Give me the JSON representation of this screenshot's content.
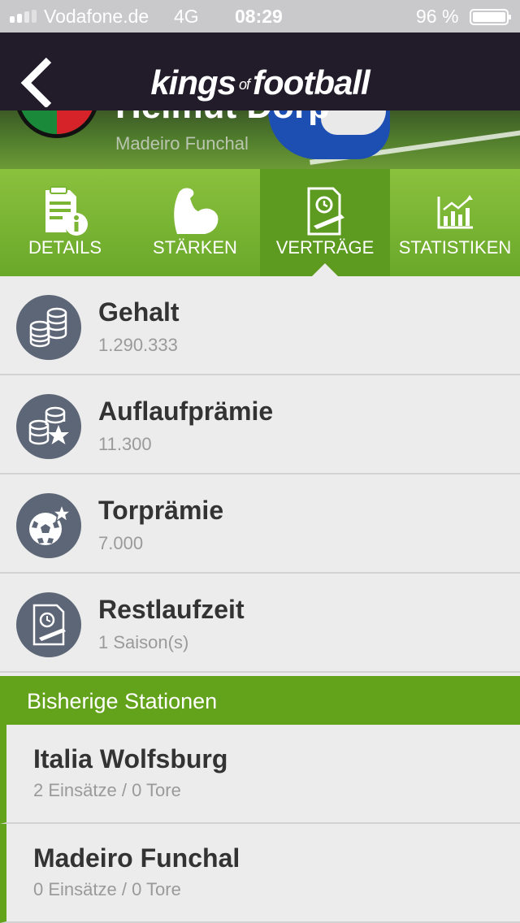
{
  "status_bar": {
    "carrier": "Vodafone.de",
    "network": "4G",
    "time": "08:29",
    "battery": "96 %"
  },
  "nav": {
    "logo_kings": "kings",
    "logo_of": "of",
    "logo_football": "football",
    "back_icon": "chevron-left-icon"
  },
  "hero": {
    "player_name": "Helmut Dorp",
    "club": "Madeiro Funchal"
  },
  "tabs": [
    {
      "label": "DETAILS",
      "icon": "document-info-icon"
    },
    {
      "label": "STÄRKEN",
      "icon": "bicep-icon"
    },
    {
      "label": "VERTRÄGE",
      "icon": "contract-icon",
      "active": true
    },
    {
      "label": "STATISTIKEN",
      "icon": "chart-icon"
    }
  ],
  "contract": [
    {
      "title": "Gehalt",
      "value": "1.290.333",
      "icon": "coins-icon"
    },
    {
      "title": "Auflaufprämie",
      "value": "11.300",
      "icon": "coins-star-icon"
    },
    {
      "title": "Torprämie",
      "value": "7.000",
      "icon": "football-star-icon"
    },
    {
      "title": "Restlaufzeit",
      "value": "1 Saison(s)",
      "icon": "contract-clock-icon"
    }
  ],
  "stations": {
    "header": "Bisherige Stationen",
    "items": [
      {
        "name": "Italia Wolfsburg",
        "stats": "2 Einsätze / 0 Tore"
      },
      {
        "name": "Madeiro Funchal",
        "stats": "0 Einsätze / 0 Tore"
      }
    ]
  },
  "colors": {
    "nav_bg": "#221b2a",
    "tab_green": "#7bb534",
    "tab_active": "#5c9b1f",
    "section_green": "#63a31c",
    "icon_circle": "#5d6676"
  }
}
